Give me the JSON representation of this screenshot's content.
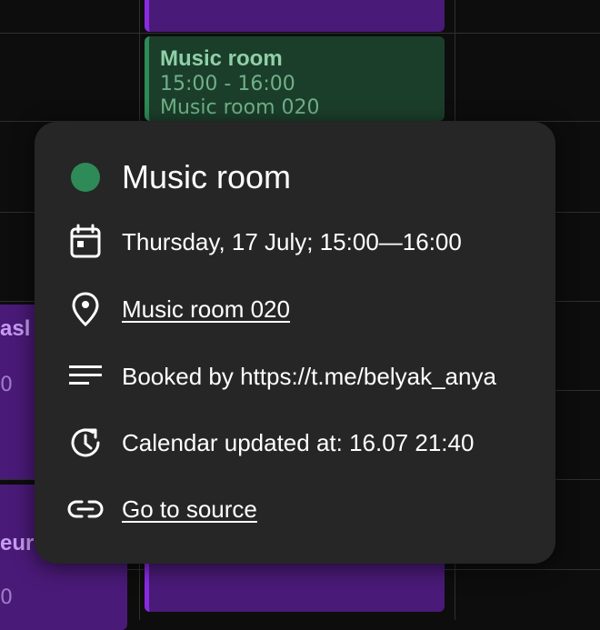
{
  "calendar": {
    "events": [
      {
        "id": "top-purple",
        "title": "",
        "time": "",
        "location": ""
      },
      {
        "id": "music-room-card",
        "title": "Music room",
        "time": "15:00 - 16:00",
        "location": "Music room 020"
      },
      {
        "id": "left-event-1",
        "title": "asl",
        "time": "0"
      },
      {
        "id": "left-event-2",
        "title": "eur",
        "time": "0"
      },
      {
        "id": "bottom-purple",
        "title": ""
      }
    ]
  },
  "popover": {
    "title": "Music room",
    "dot_color": "#2e8b57",
    "date_time": "Thursday, 17 July; 15:00—16:00",
    "location": "Music room 020",
    "description": "Booked by https://t.me/belyak_anya",
    "updated": "Calendar updated at: 16.07 21:40",
    "source_link": "Go to source",
    "icons": {
      "date": "calendar-icon",
      "location": "location-pin-icon",
      "description": "text-lines-icon",
      "updated": "clock-refresh-icon",
      "source": "link-icon"
    }
  }
}
